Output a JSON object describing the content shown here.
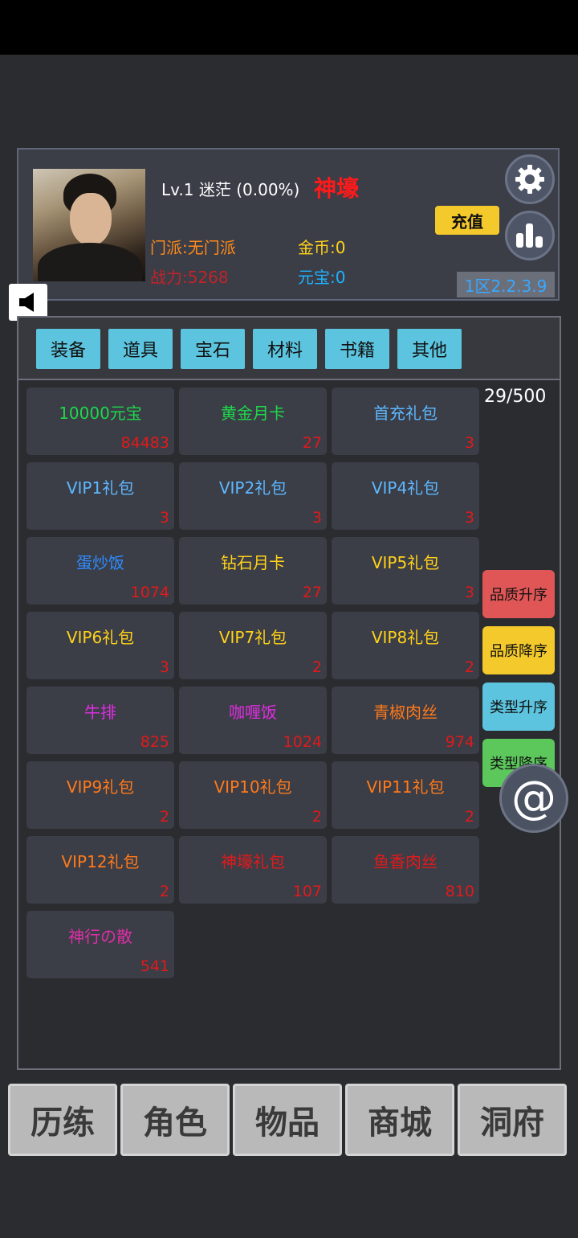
{
  "profile": {
    "level_text": "Lv.1 迷茫  (0.00%)",
    "title": "神壕",
    "sect": "门派:无门派",
    "power": "战力:5268",
    "gold": "金币:0",
    "yuanbao": "元宝:0",
    "recharge_label": "充值",
    "version": "1区2.2.3.9"
  },
  "icons": {
    "settings": "gear-icon",
    "stats": "bar-chart-icon",
    "sound": "speaker-icon",
    "contact": "at-sign-icon"
  },
  "tabs": [
    "装备",
    "道具",
    "宝石",
    "材料",
    "书籍",
    "其他"
  ],
  "inventory": {
    "count": "29/500",
    "items": [
      {
        "name": "10000元宝",
        "qty": "84483",
        "color": "#1ed84a"
      },
      {
        "name": "黄金月卡",
        "qty": "27",
        "color": "#1ed84a"
      },
      {
        "name": "首充礼包",
        "qty": "3",
        "color": "#5db8ff"
      },
      {
        "name": "VIP1礼包",
        "qty": "3",
        "color": "#5db8ff"
      },
      {
        "name": "VIP2礼包",
        "qty": "3",
        "color": "#5db8ff"
      },
      {
        "name": "VIP4礼包",
        "qty": "3",
        "color": "#5db8ff"
      },
      {
        "name": "蛋炒饭",
        "qty": "1074",
        "color": "#2f8cff"
      },
      {
        "name": "钻石月卡",
        "qty": "27",
        "color": "#ffd21a"
      },
      {
        "name": "VIP5礼包",
        "qty": "3",
        "color": "#ffd21a"
      },
      {
        "name": "VIP6礼包",
        "qty": "3",
        "color": "#ffd21a"
      },
      {
        "name": "VIP7礼包",
        "qty": "2",
        "color": "#ffd21a"
      },
      {
        "name": "VIP8礼包",
        "qty": "2",
        "color": "#ffd21a"
      },
      {
        "name": "牛排",
        "qty": "825",
        "color": "#e02ee0"
      },
      {
        "name": "咖喱饭",
        "qty": "1024",
        "color": "#e02ee0"
      },
      {
        "name": "青椒肉丝",
        "qty": "974",
        "color": "#ff7a1a"
      },
      {
        "name": "VIP9礼包",
        "qty": "2",
        "color": "#ff7a1a"
      },
      {
        "name": "VIP10礼包",
        "qty": "2",
        "color": "#ff7a1a"
      },
      {
        "name": "VIP11礼包",
        "qty": "2",
        "color": "#ff7a1a"
      },
      {
        "name": "VIP12礼包",
        "qty": "2",
        "color": "#ff7a1a"
      },
      {
        "name": "神壕礼包",
        "qty": "107",
        "color": "#e11a1a"
      },
      {
        "name": "鱼香肉丝",
        "qty": "810",
        "color": "#e11a1a"
      },
      {
        "name": "神行の散",
        "qty": "541",
        "color": "#e02ea8"
      }
    ]
  },
  "sort_buttons": [
    {
      "label": "品质升序",
      "color": "#e05656"
    },
    {
      "label": "品质降序",
      "color": "#f4c92c"
    },
    {
      "label": "类型升序",
      "color": "#5cc4de"
    },
    {
      "label": "类型降序",
      "color": "#5cc85c"
    }
  ],
  "bottom_nav": [
    "历练",
    "角色",
    "物品",
    "商城",
    "洞府"
  ]
}
